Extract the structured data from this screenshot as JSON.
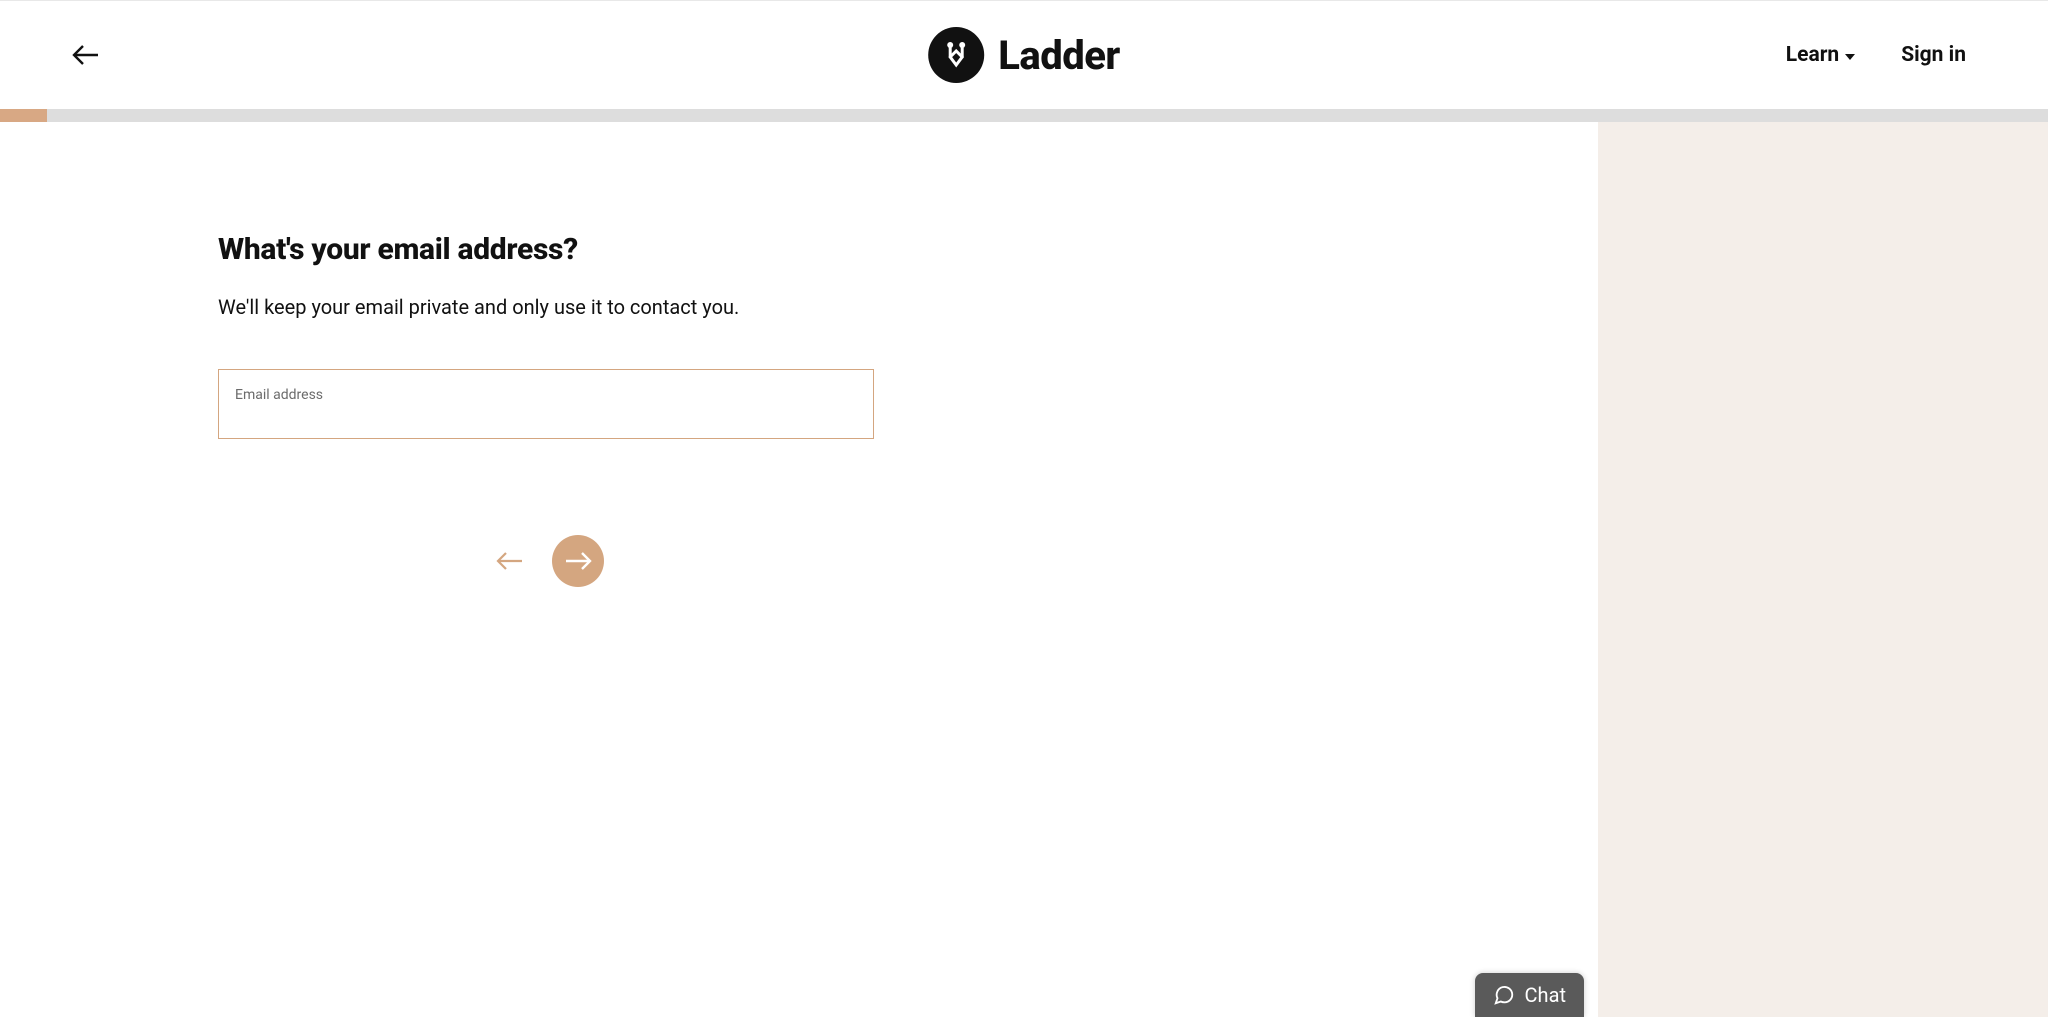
{
  "header": {
    "brand_name": "Ladder",
    "learn_label": "Learn",
    "signin_label": "Sign in"
  },
  "progress": {
    "percent": 2.3
  },
  "form": {
    "heading": "What's your email address?",
    "subtext": "We'll keep your email private and only use it to contact you.",
    "email_label": "Email address",
    "email_value": ""
  },
  "chat": {
    "label": "Chat"
  },
  "colors": {
    "accent": "#d4a680",
    "side_bg": "#f4eee9",
    "progress_bg": "#dddddd"
  }
}
